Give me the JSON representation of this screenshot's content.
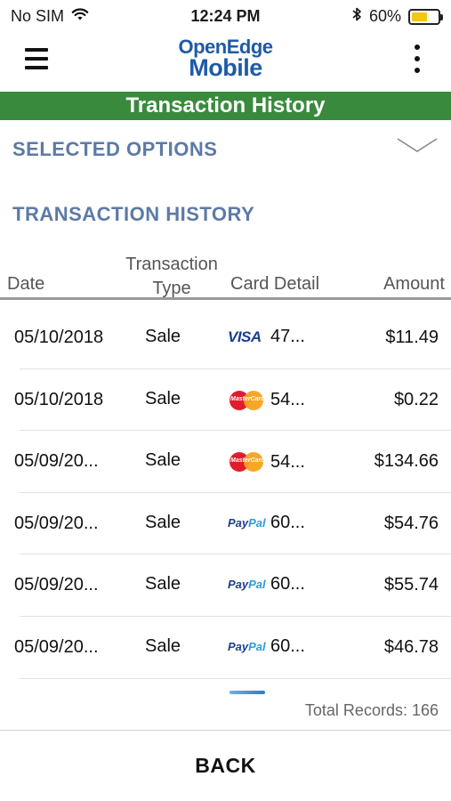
{
  "status_bar": {
    "carrier": "No SIM",
    "time": "12:24 PM",
    "battery_percent": "60%",
    "battery_level": 0.6,
    "icons": [
      "wifi-icon",
      "bluetooth-icon",
      "battery-icon"
    ]
  },
  "header": {
    "logo_line1": "OpenEdge",
    "logo_line2": "Mobile",
    "menu_icon": "hamburger-icon",
    "more_icon": "kebab-icon"
  },
  "title_bar": {
    "title": "Transaction History"
  },
  "selected_options": {
    "label": "SELECTED OPTIONS",
    "icon": "chevron-down-icon"
  },
  "section": {
    "heading": "TRANSACTION HISTORY"
  },
  "table": {
    "headers": {
      "date": "Date",
      "type_line1": "Transaction",
      "type_line2": "Type",
      "card": "Card Detail",
      "amount": "Amount"
    },
    "rows": [
      {
        "date": "05/10/2018",
        "type": "Sale",
        "card_brand": "visa",
        "card": "47...",
        "amount": "$11.49"
      },
      {
        "date": "05/10/2018",
        "type": "Sale",
        "card_brand": "mastercard",
        "card": "54...",
        "amount": "$0.22"
      },
      {
        "date": "05/09/20...",
        "type": "Sale",
        "card_brand": "mastercard",
        "card": "54...",
        "amount": "$134.66"
      },
      {
        "date": "05/09/20...",
        "type": "Sale",
        "card_brand": "paypal",
        "card": "60...",
        "amount": "$54.76"
      },
      {
        "date": "05/09/20...",
        "type": "Sale",
        "card_brand": "paypal",
        "card": "60...",
        "amount": "$55.74"
      },
      {
        "date": "05/09/20...",
        "type": "Sale",
        "card_brand": "paypal",
        "card": "60...",
        "amount": "$46.78"
      }
    ]
  },
  "brands": {
    "visa": "VISA",
    "mastercard": "MasterCard",
    "paypal_part1": "Pay",
    "paypal_part2": "Pal"
  },
  "footer": {
    "total_records": "Total Records: 166",
    "back_label": "BACK"
  },
  "colors": {
    "brand_blue": "#1e5aa8",
    "title_green": "#3a8a3e",
    "section_blue": "#5d7aa6"
  }
}
